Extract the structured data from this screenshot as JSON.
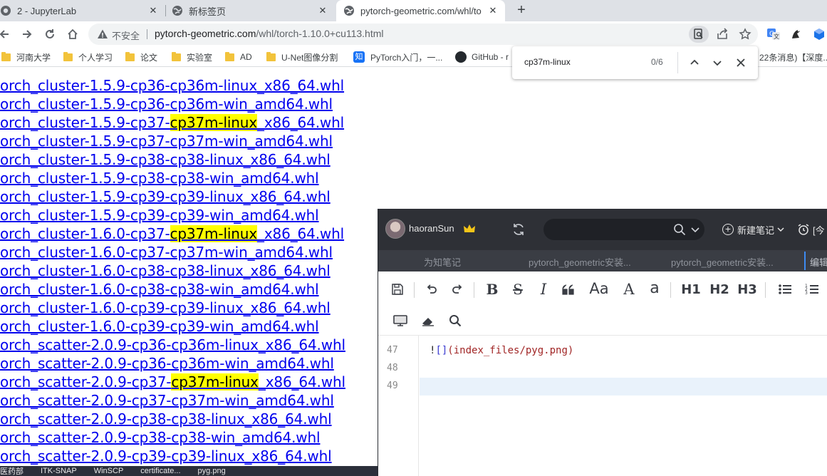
{
  "tabs": [
    {
      "label": "2 - JupyterLab",
      "icon": "jupyter-icon"
    },
    {
      "label": "新标签页",
      "icon": "globe-icon"
    },
    {
      "label": "pytorch-geometric.com/whl/to",
      "icon": "globe-icon",
      "active": true
    }
  ],
  "omnibox": {
    "insecure_label": "不安全",
    "host": "pytorch-geometric.com",
    "path": "/whl/torch-1.10.0+cu113.html"
  },
  "bookmarks": [
    {
      "label": "河南大学",
      "icon": "folder-icon"
    },
    {
      "label": "个人学习",
      "icon": "folder-icon"
    },
    {
      "label": "论文",
      "icon": "folder-icon"
    },
    {
      "label": "实验室",
      "icon": "folder-icon"
    },
    {
      "label": "AD",
      "icon": "folder-icon"
    },
    {
      "label": "U-Net图像分割",
      "icon": "folder-icon"
    },
    {
      "label": "PyTorch入门，一...",
      "icon": "zhihu-icon"
    },
    {
      "label": "GitHub - r",
      "icon": "github-icon"
    },
    {
      "label": "22条消息)【深度...",
      "icon": "none"
    }
  ],
  "find": {
    "query": "cp37m-linux",
    "count": "0/6"
  },
  "links": [
    {
      "pre": "orch_cluster-1.5.9-cp36-cp36m-linux_x86_64.whl",
      "hl": "",
      "post": ""
    },
    {
      "pre": "orch_cluster-1.5.9-cp36-cp36m-win_amd64.whl",
      "hl": "",
      "post": ""
    },
    {
      "pre": "orch_cluster-1.5.9-cp37-",
      "hl": "cp37m-linux",
      "post": "_x86_64.whl"
    },
    {
      "pre": "orch_cluster-1.5.9-cp37-cp37m-win_amd64.whl",
      "hl": "",
      "post": ""
    },
    {
      "pre": "orch_cluster-1.5.9-cp38-cp38-linux_x86_64.whl",
      "hl": "",
      "post": ""
    },
    {
      "pre": "orch_cluster-1.5.9-cp38-cp38-win_amd64.whl",
      "hl": "",
      "post": ""
    },
    {
      "pre": "orch_cluster-1.5.9-cp39-cp39-linux_x86_64.whl",
      "hl": "",
      "post": ""
    },
    {
      "pre": "orch_cluster-1.5.9-cp39-cp39-win_amd64.whl",
      "hl": "",
      "post": ""
    },
    {
      "pre": "orch_cluster-1.6.0-cp37-",
      "hl": "cp37m-linux",
      "post": "_x86_64.whl"
    },
    {
      "pre": "orch_cluster-1.6.0-cp37-cp37m-win_amd64.whl",
      "hl": "",
      "post": ""
    },
    {
      "pre": "orch_cluster-1.6.0-cp38-cp38-linux_x86_64.whl",
      "hl": "",
      "post": ""
    },
    {
      "pre": "orch_cluster-1.6.0-cp38-cp38-win_amd64.whl",
      "hl": "",
      "post": ""
    },
    {
      "pre": "orch_cluster-1.6.0-cp39-cp39-linux_x86_64.whl",
      "hl": "",
      "post": ""
    },
    {
      "pre": "orch_cluster-1.6.0-cp39-cp39-win_amd64.whl",
      "hl": "",
      "post": ""
    },
    {
      "pre": "orch_scatter-2.0.9-cp36-cp36m-linux_x86_64.whl",
      "hl": "",
      "post": ""
    },
    {
      "pre": "orch_scatter-2.0.9-cp36-cp36m-win_amd64.whl",
      "hl": "",
      "post": ""
    },
    {
      "pre": "orch_scatter-2.0.9-cp37-",
      "hl": "cp37m-linux",
      "post": "_x86_64.whl"
    },
    {
      "pre": "orch_scatter-2.0.9-cp37-cp37m-win_amd64.whl",
      "hl": "",
      "post": ""
    },
    {
      "pre": "orch_scatter-2.0.9-cp38-cp38-linux_x86_64.whl",
      "hl": "",
      "post": ""
    },
    {
      "pre": "orch_scatter-2.0.9-cp38-cp38-win_amd64.whl",
      "hl": "",
      "post": ""
    },
    {
      "pre": "orch_scatter-2.0.9-cp39-cp39-linux_x86_64.whl",
      "hl": "",
      "post": ""
    }
  ],
  "taskbar": [
    "医药部",
    "ITK-SNAP",
    "WinSCP",
    "certificate...",
    "pyg.png"
  ],
  "notes_app": {
    "username": "haoranSun",
    "new_note_label": "新建笔记",
    "alarm_label": "[今",
    "tabs": [
      "为知笔记",
      "pytorch_geometric安装...",
      "pytorch_geometric安装...",
      "编辑"
    ],
    "toolbar": {
      "strike": "S",
      "italic": "I",
      "bold": "B",
      "font_size": "Aa",
      "font_color": "A",
      "highlight": "a",
      "h1": "H1",
      "h2": "H2",
      "h3": "H3"
    },
    "line_numbers": [
      "47",
      "48",
      "49"
    ],
    "code": {
      "bang": "!",
      "brackets": "[]",
      "path": "(index_files/pyg.png)"
    }
  }
}
